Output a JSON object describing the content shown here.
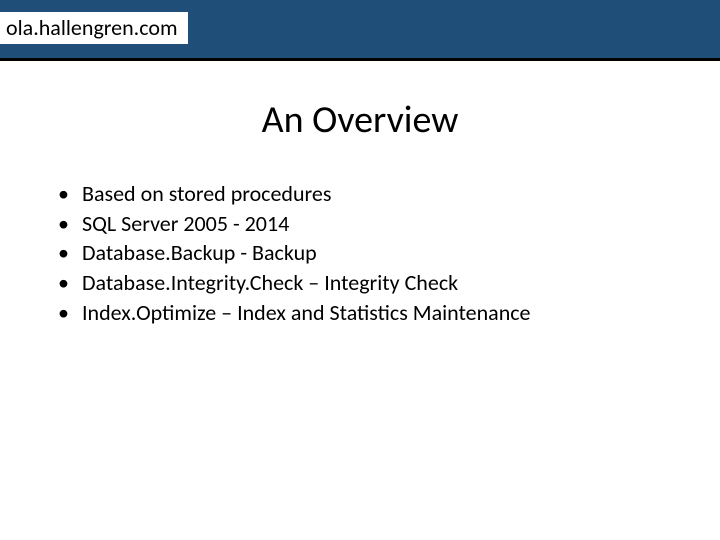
{
  "header": {
    "url": "ola.hallengren.com"
  },
  "title": "An Overview",
  "bullets": [
    "Based on stored procedures",
    "SQL Server 2005 - 2014",
    "Database.Backup - Backup",
    "Database.Integrity.Check – Integrity Check",
    "Index.Optimize – Index and Statistics Maintenance"
  ]
}
